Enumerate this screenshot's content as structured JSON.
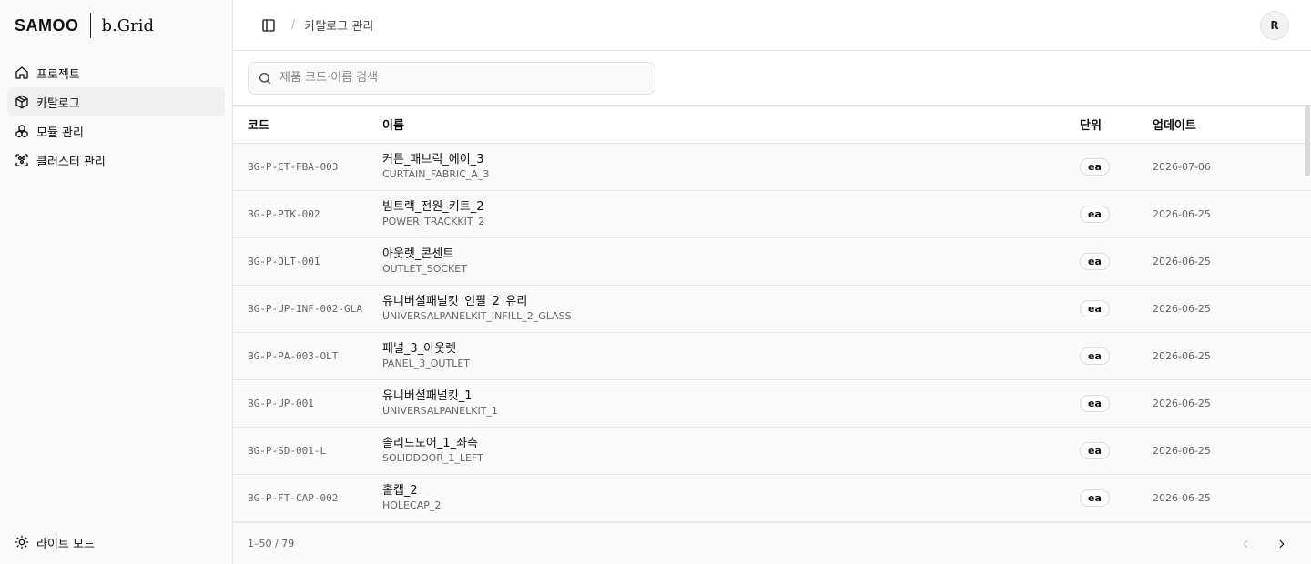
{
  "brand": {
    "company": "SAMOO",
    "product": "b.Grid"
  },
  "sidebar": {
    "items": [
      {
        "label": "프로젝트",
        "icon": "home-icon",
        "active": false
      },
      {
        "label": "카탈로그",
        "icon": "package-icon",
        "active": true
      },
      {
        "label": "모듈 관리",
        "icon": "boxes-icon",
        "active": false
      },
      {
        "label": "클러스터 관리",
        "icon": "scan-cluster-icon",
        "active": false
      }
    ],
    "theme_label": "라이트 모드"
  },
  "header": {
    "breadcrumb": "카탈로그 관리",
    "avatar_initial": "R"
  },
  "search": {
    "placeholder": "제품 코드·이름 검색",
    "value": ""
  },
  "table": {
    "columns": {
      "code": "코드",
      "name": "이름",
      "unit": "단위",
      "updated": "업데이트"
    },
    "rows": [
      {
        "code": "BG-P-CT-FBA-003",
        "name_ko": "커튼_패브릭_에이_3",
        "name_en": "CURTAIN_FABRIC_A_3",
        "unit": "ea",
        "updated": "2026-07-06"
      },
      {
        "code": "BG-P-PTK-002",
        "name_ko": "빔트랙_전원_키트_2",
        "name_en": "POWER_TRACKKIT_2",
        "unit": "ea",
        "updated": "2026-06-25"
      },
      {
        "code": "BG-P-OLT-001",
        "name_ko": "아웃렛_콘센트",
        "name_en": "OUTLET_SOCKET",
        "unit": "ea",
        "updated": "2026-06-25"
      },
      {
        "code": "BG-P-UP-INF-002-GLA",
        "name_ko": "유니버셜패널킷_인필_2_유리",
        "name_en": "UNIVERSALPANELKIT_INFILL_2_GLASS",
        "unit": "ea",
        "updated": "2026-06-25"
      },
      {
        "code": "BG-P-PA-003-OLT",
        "name_ko": "패널_3_아웃렛",
        "name_en": "PANEL_3_OUTLET",
        "unit": "ea",
        "updated": "2026-06-25"
      },
      {
        "code": "BG-P-UP-001",
        "name_ko": "유니버셜패널킷_1",
        "name_en": "UNIVERSALPANELKIT_1",
        "unit": "ea",
        "updated": "2026-06-25"
      },
      {
        "code": "BG-P-SD-001-L",
        "name_ko": "솔리드도어_1_좌측",
        "name_en": "SOLIDDOOR_1_LEFT",
        "unit": "ea",
        "updated": "2026-06-25"
      },
      {
        "code": "BG-P-FT-CAP-002",
        "name_ko": "홀캡_2",
        "name_en": "HOLECAP_2",
        "unit": "ea",
        "updated": "2026-06-25"
      }
    ]
  },
  "pagination": {
    "info": "1–50 / 79"
  }
}
